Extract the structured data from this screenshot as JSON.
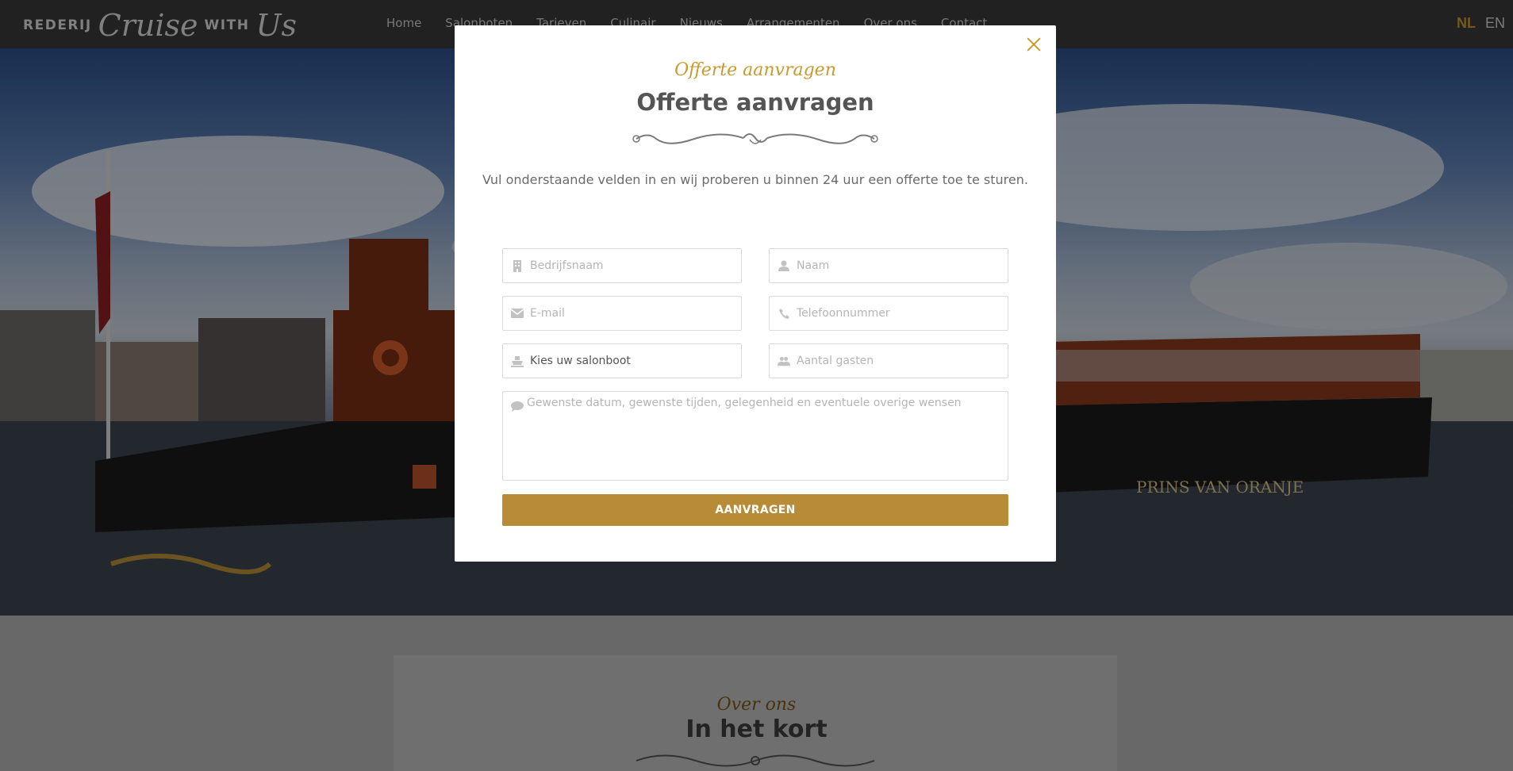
{
  "header": {
    "logo_small_1": "REDERIJ",
    "logo_script_1": "Cruise",
    "logo_small_2": "WITH",
    "logo_script_2": "Us",
    "nav": [
      "Home",
      "Salonboten",
      "Tarieven",
      "Culinair",
      "Nieuws",
      "Arrangementen",
      "Over ons",
      "Contact"
    ],
    "lang_active": "NL",
    "lang_other": "EN"
  },
  "hero": {
    "boat_name": "PRINS VAN ORANJE"
  },
  "below": {
    "kicker": "Over ons",
    "heading": "In het kort"
  },
  "modal": {
    "kicker": "Offerte aanvragen",
    "title": "Offerte aanvragen",
    "intro": "Vul onderstaande velden in en wij proberen u binnen 24 uur een offerte toe te sturen.",
    "fields": {
      "company_placeholder": "Bedrijfsnaam",
      "name_placeholder": "Naam",
      "email_placeholder": "E-mail",
      "phone_placeholder": "Telefoonnummer",
      "boat_selected": "Kies uw salonboot",
      "guests_placeholder": "Aantal gasten",
      "message_placeholder": "Gewenste datum, gewenste tijden, gelegenheid en eventuele overige wensen"
    },
    "submit_label": "AANVRAGEN"
  },
  "icons": {
    "company": "building-icon",
    "name": "user-icon",
    "email": "envelope-icon",
    "phone": "phone-icon",
    "boat": "ship-icon",
    "guests": "users-icon",
    "message": "comment-icon",
    "close": "close-icon"
  },
  "colors": {
    "accent": "#c99a2e",
    "button": "#b88c36",
    "topbar": "#3a3a3a"
  }
}
